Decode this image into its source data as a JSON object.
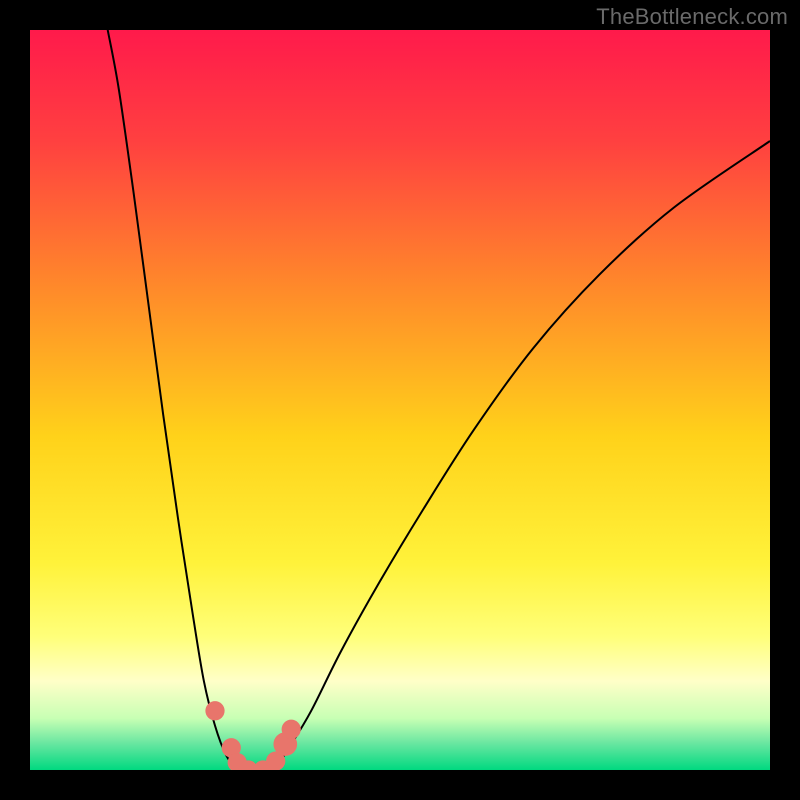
{
  "watermark": "TheBottleneck.com",
  "chart_data": {
    "type": "line",
    "title": "",
    "xlabel": "",
    "ylabel": "",
    "xlim": [
      0,
      100
    ],
    "ylim": [
      0,
      100
    ],
    "grid": false,
    "legend": false,
    "background_gradient": {
      "stops": [
        {
          "offset": 0.0,
          "color": "#ff1a4b"
        },
        {
          "offset": 0.15,
          "color": "#ff4040"
        },
        {
          "offset": 0.35,
          "color": "#ff8a2a"
        },
        {
          "offset": 0.55,
          "color": "#ffd21a"
        },
        {
          "offset": 0.72,
          "color": "#fff23a"
        },
        {
          "offset": 0.82,
          "color": "#ffff7a"
        },
        {
          "offset": 0.88,
          "color": "#ffffc8"
        },
        {
          "offset": 0.93,
          "color": "#c8ffb4"
        },
        {
          "offset": 0.965,
          "color": "#66e6a0"
        },
        {
          "offset": 1.0,
          "color": "#00d980"
        }
      ]
    },
    "series": [
      {
        "name": "left-branch",
        "x": [
          10.5,
          12,
          14,
          16,
          18,
          20,
          22,
          23.5,
          25,
          26.5,
          28
        ],
        "y": [
          100,
          92,
          78,
          63,
          48,
          34,
          21,
          12,
          6,
          2,
          0
        ]
      },
      {
        "name": "right-branch",
        "x": [
          33,
          35,
          38,
          42,
          47,
          53,
          60,
          68,
          77,
          87,
          100
        ],
        "y": [
          0,
          3,
          8,
          16,
          25,
          35,
          46,
          57,
          67,
          76,
          85
        ]
      },
      {
        "name": "flat-bottom",
        "x": [
          28,
          30.5,
          33
        ],
        "y": [
          0,
          0,
          0
        ]
      }
    ],
    "markers": [
      {
        "x": 25.0,
        "y": 8.0,
        "r": 1.3
      },
      {
        "x": 27.2,
        "y": 3.0,
        "r": 1.3
      },
      {
        "x": 28.0,
        "y": 1.0,
        "r": 1.3
      },
      {
        "x": 29.5,
        "y": 0.0,
        "r": 1.3
      },
      {
        "x": 31.5,
        "y": 0.0,
        "r": 1.3
      },
      {
        "x": 33.2,
        "y": 1.2,
        "r": 1.3
      },
      {
        "x": 34.5,
        "y": 3.5,
        "r": 1.6
      },
      {
        "x": 35.3,
        "y": 5.5,
        "r": 1.3
      }
    ],
    "marker_style": {
      "fill": "#e8756b",
      "stroke": "none"
    },
    "line_style": {
      "stroke": "#000000",
      "width": 0.25
    }
  }
}
